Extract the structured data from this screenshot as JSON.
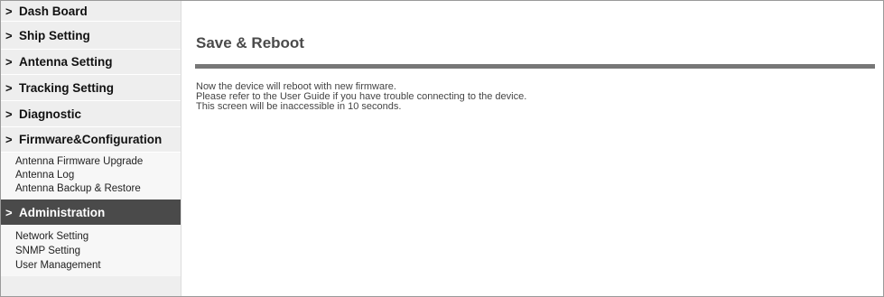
{
  "sidebar": {
    "sections": [
      {
        "label": "Dash Board",
        "active": false
      },
      {
        "label": "Ship Setting",
        "active": false
      },
      {
        "label": "Antenna Setting",
        "active": false
      },
      {
        "label": "Tracking Setting",
        "active": false
      },
      {
        "label": "Diagnostic",
        "active": false
      },
      {
        "label": "Firmware&Configuration",
        "active": false,
        "items": [
          "Antenna Firmware Upgrade",
          "Antenna Log",
          "Antenna Backup & Restore"
        ]
      },
      {
        "label": "Administration",
        "active": true,
        "items": [
          "Network Setting",
          "SNMP Setting",
          "User Management"
        ]
      }
    ],
    "chevron": ">"
  },
  "main": {
    "title": "Save & Reboot",
    "messages": [
      "Now the device will reboot with new firmware.",
      "Please refer to the User Guide if you have trouble connecting to the device.",
      "This screen will be inaccessible in 10 seconds."
    ]
  },
  "colors": {
    "active_nav_bg": "#4a4a4a",
    "sidebar_bg": "#eeeeee",
    "title_rule": "#777777"
  }
}
